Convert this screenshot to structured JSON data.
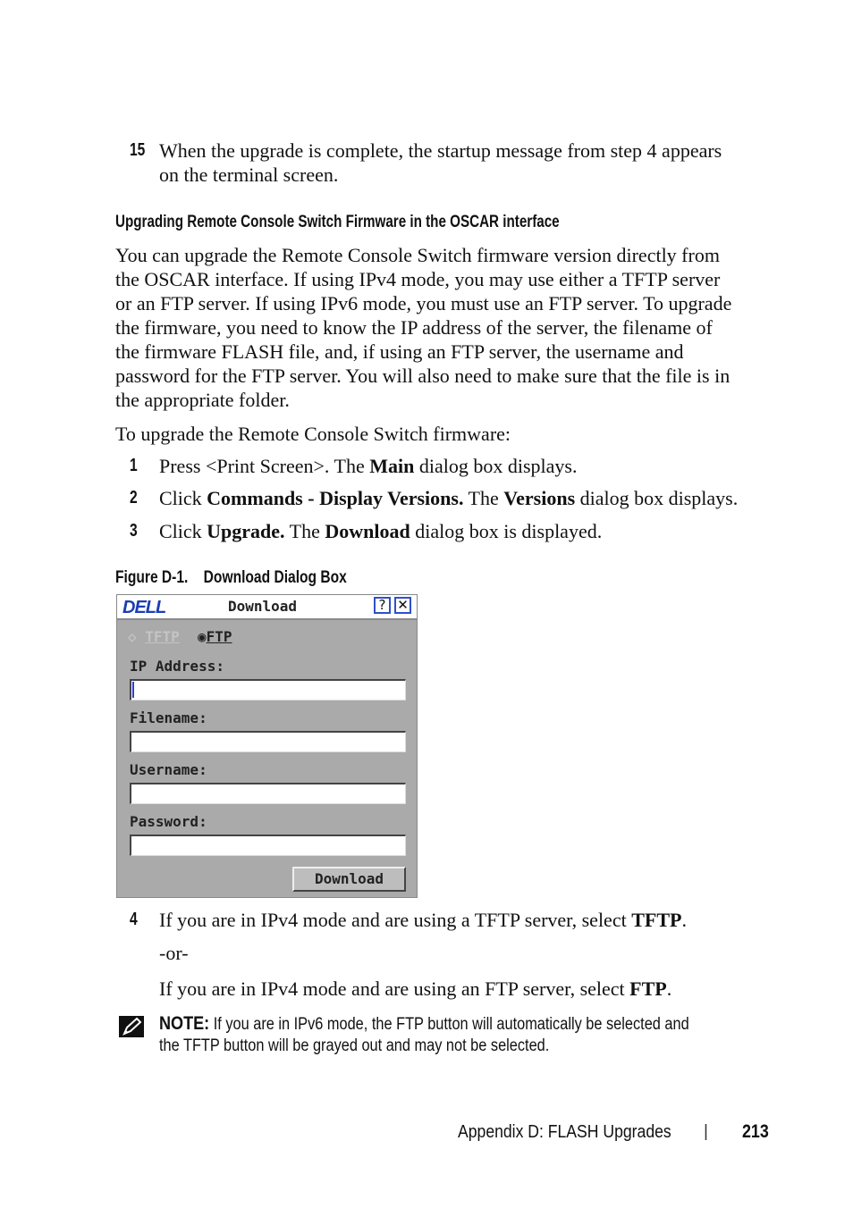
{
  "step15": {
    "num": "15",
    "text1": "When the upgrade is complete, the startup message from step 4 appears",
    "text2": "on the terminal screen."
  },
  "section_heading": "Upgrading Remote Console Switch Firmware in the OSCAR interface",
  "intro_lines": [
    "You can upgrade the Remote Console Switch firmware version directly from",
    "the OSCAR interface. If using IPv4 mode, you may use either a TFTP server",
    "or an FTP server. If using IPv6 mode, you must use an FTP server. To upgrade",
    "the firmware, you need to know the IP address of the server, the filename of",
    "the firmware FLASH file, and, if using an FTP server, the username and",
    "password for the FTP server. You will also need to make sure that the file is in",
    "the appropriate folder."
  ],
  "lead_in": "To upgrade the Remote Console Switch firmware:",
  "steps": [
    {
      "num": "1",
      "a": "Press <Print Screen>. The ",
      "b": "Main",
      "c": " dialog box displays."
    },
    {
      "num": "2",
      "a": "Click ",
      "b": "Commands - Display Versions.",
      "c": " The ",
      "d": "Versions",
      "e": " dialog box displays."
    },
    {
      "num": "3",
      "a": "Click ",
      "b": "Upgrade.",
      "c": " The ",
      "d": "Download",
      "e": " dialog box is displayed."
    }
  ],
  "figure_caption": "Figure D-1.    Download Dialog Box",
  "dialog": {
    "logo": "DELL",
    "title": "Download",
    "help_icon": "?",
    "close_icon": "✕",
    "radio_tftp": "TFTP",
    "radio_ftp": "FTP",
    "selected_protocol": "FTP",
    "fields": [
      {
        "label": "IP Address:",
        "value": ""
      },
      {
        "label": "Filename:",
        "value": ""
      },
      {
        "label": "Username:",
        "value": ""
      },
      {
        "label": "Password:",
        "value": ""
      }
    ],
    "download_button": "Download"
  },
  "step4": {
    "num": "4",
    "a": "If you are in IPv4 mode and are using a TFTP server, select ",
    "b": "TFTP",
    "c": "."
  },
  "or_text": "-or-",
  "step4b": {
    "a": "If you are in IPv4 mode and are using an FTP server, select ",
    "b": "FTP",
    "c": "."
  },
  "note": {
    "label": "NOTE:",
    "line1": " If you are in IPv6 mode, the FTP button will automatically be selected and",
    "line2": "the TFTP button will be grayed out and may not be selected."
  },
  "footer": {
    "section": "Appendix D: FLASH Upgrades",
    "separator": "|",
    "page": "213"
  }
}
